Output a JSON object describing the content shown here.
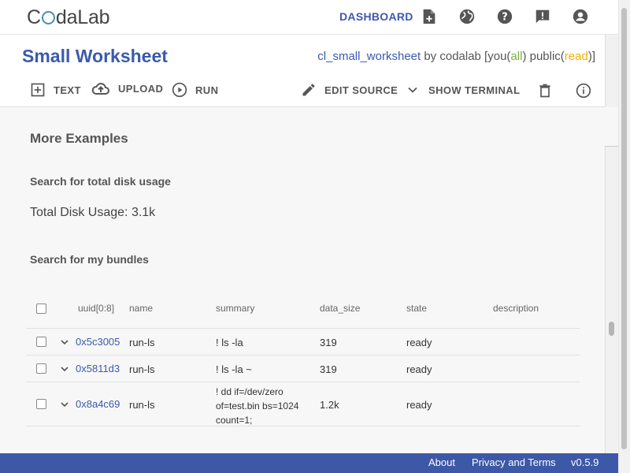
{
  "topbar": {
    "logo_pre": "C",
    "logo_post": "daLab",
    "dashboard": "DASHBOARD",
    "icons": [
      "new-worksheet-icon",
      "globe-icon",
      "help-icon",
      "feedback-icon",
      "account-icon"
    ]
  },
  "worksheet": {
    "title": "Small Worksheet",
    "name": "cl_small_worksheet",
    "by": " by codalab [you(",
    "you_perm": "all",
    "mid": ") public(",
    "public_perm": "read",
    "end": ")]"
  },
  "toolbar": {
    "text": "TEXT",
    "upload": "UPLOAD",
    "run": "RUN",
    "edit_source": "EDIT SOURCE",
    "show_terminal": "SHOW TERMINAL"
  },
  "content": {
    "section_title": "More Examples",
    "query1": "Search for total disk usage",
    "disk_usage": "Total Disk Usage: 3.1k",
    "query2": "Search for my bundles"
  },
  "table": {
    "headers": [
      "uuid[0:8]",
      "name",
      "summary",
      "data_size",
      "state",
      "description"
    ],
    "rows": [
      {
        "uuid": "0x5c3005",
        "name": "run-ls",
        "summary": "! ls -la",
        "data_size": "319",
        "state": "ready",
        "description": ""
      },
      {
        "uuid": "0x5811d3",
        "name": "run-ls",
        "summary": "! ls -la ~",
        "data_size": "319",
        "state": "ready",
        "description": ""
      },
      {
        "uuid": "0x8a4c69",
        "name": "run-ls",
        "summary": "! dd if=/dev/zero of=test.bin bs=1024 count=1;",
        "data_size": "1.2k",
        "state": "ready",
        "description": ""
      }
    ]
  },
  "footer": {
    "about": "About",
    "privacy": "Privacy and Terms",
    "version": "v0.5.9"
  },
  "colors": {
    "brand": "#3a5aad",
    "footer": "#3d58a6",
    "green": "#7cb342",
    "yellow": "#f2b300"
  }
}
